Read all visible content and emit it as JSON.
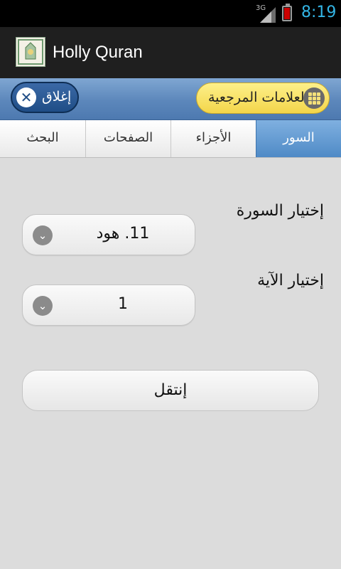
{
  "status_bar": {
    "network_label": "3G",
    "time": "8:19",
    "battery_color": "#cc0000"
  },
  "action_bar": {
    "title": "Holly Quran"
  },
  "toolbar": {
    "close_label": "إغلاق",
    "bookmarks_label": "العلامات المرجعية"
  },
  "tabs": [
    {
      "label": "البحث",
      "active": false
    },
    {
      "label": "الصفحات",
      "active": false
    },
    {
      "label": "الأجزاء",
      "active": false
    },
    {
      "label": "السور",
      "active": true
    }
  ],
  "form": {
    "surah_label": "إختيار السورة",
    "surah_value": "11. هود",
    "ayah_label": "إختيار الآية",
    "ayah_value": "1",
    "go_label": "إنتقل"
  },
  "colors": {
    "accent_blue": "#33b5e5",
    "toolbar_blue": "#5c87bb",
    "bookmark_yellow": "#f3d54a"
  }
}
